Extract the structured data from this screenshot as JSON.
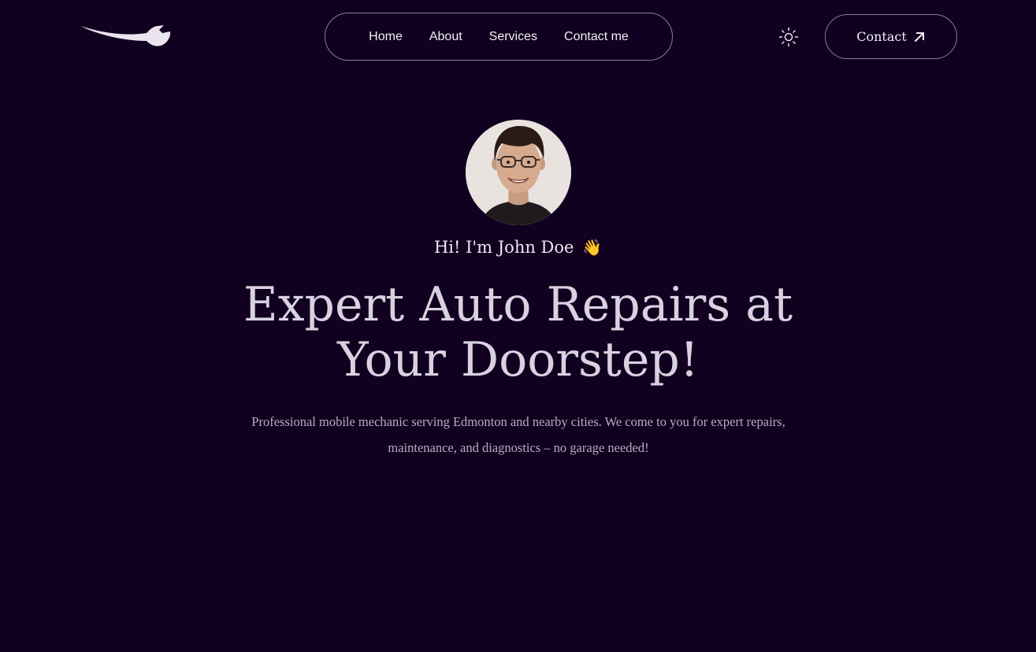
{
  "header": {
    "logo": {
      "icon": "wrench-logo-icon",
      "color": "#e9e4ee"
    },
    "nav": [
      {
        "label": "Home"
      },
      {
        "label": "About"
      },
      {
        "label": "Services"
      },
      {
        "label": "Contact me"
      }
    ],
    "theme_toggle": {
      "icon": "sun-icon"
    },
    "contact_button": {
      "label": "Contact",
      "icon": "arrow-up-right-icon"
    }
  },
  "hero": {
    "avatar": {
      "icon": "profile-photo"
    },
    "greeting": "Hi! I'm John Doe",
    "greeting_emoji": "👋",
    "headline_line1": "Expert Auto Repairs at",
    "headline_line2": "Your Doorstep!",
    "description": "Professional mobile mechanic serving Edmonton and nearby cities. We come to you for expert repairs, maintenance, and diagnostics – no garage needed!"
  },
  "colors": {
    "background": "#11001f",
    "border": "#857f96",
    "text": "#ece6f0",
    "muted_text": "#b5aec0"
  }
}
